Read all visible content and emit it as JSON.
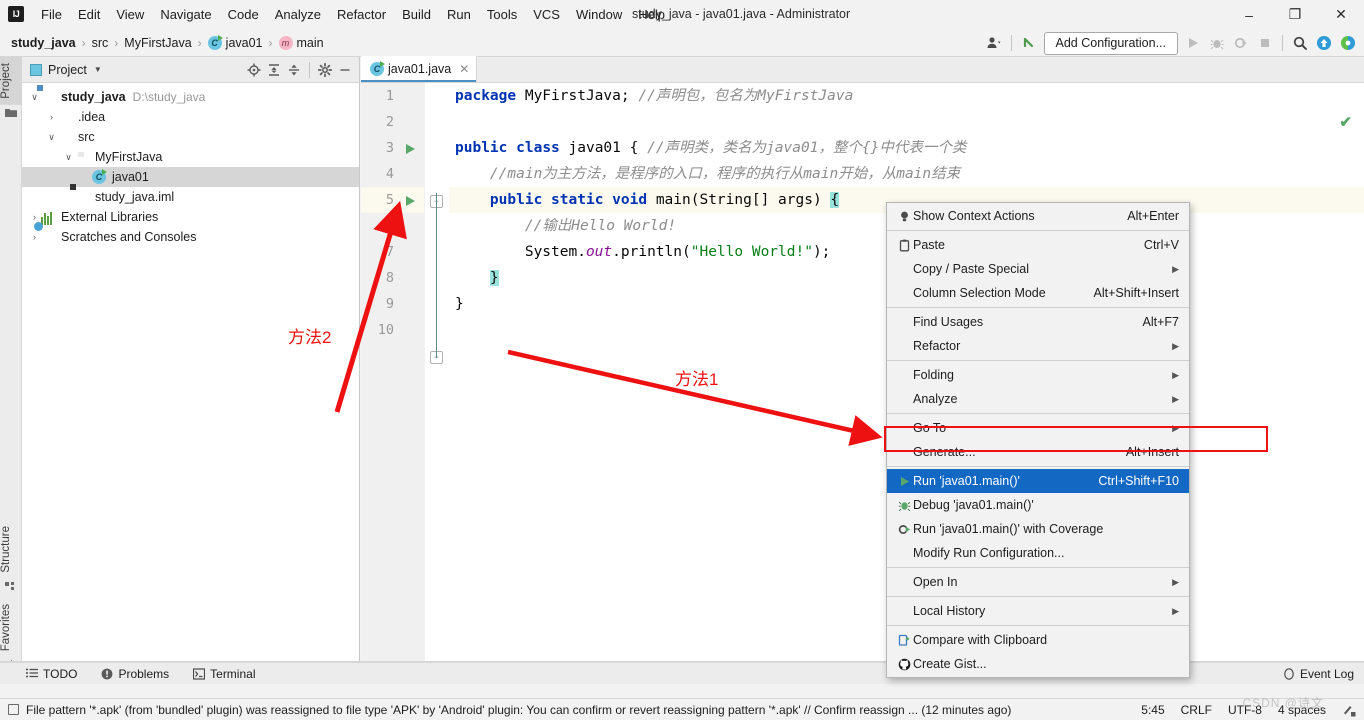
{
  "window": {
    "title": "study_java - java01.java - Administrator",
    "logo": "IJ",
    "minimize": "–",
    "maximize": "❐",
    "close": "✕"
  },
  "menubar": {
    "items": [
      {
        "label": "File"
      },
      {
        "label": "Edit"
      },
      {
        "label": "View"
      },
      {
        "label": "Navigate"
      },
      {
        "label": "Code"
      },
      {
        "label": "Analyze"
      },
      {
        "label": "Refactor"
      },
      {
        "label": "Build"
      },
      {
        "label": "Run"
      },
      {
        "label": "Tools"
      },
      {
        "label": "VCS"
      },
      {
        "label": "Window"
      },
      {
        "label": "Help"
      }
    ]
  },
  "breadcrumb": {
    "items": [
      {
        "label": "study_java",
        "icon": "none"
      },
      {
        "label": "src",
        "icon": "none"
      },
      {
        "label": "MyFirstJava",
        "icon": "none"
      },
      {
        "label": "java01",
        "icon": "class-icon"
      },
      {
        "label": "main",
        "icon": "method-icon"
      }
    ],
    "separator": "›"
  },
  "nav_toolbar": {
    "add_configuration": "Add Configuration...",
    "icons": [
      "user-avatar-icon",
      "back-arrow-icon",
      "run-icon",
      "debug-icon",
      "run-coverage-icon",
      "stop-icon",
      "search-everywhere-icon",
      "update-project-icon",
      "ide-assistant-icon"
    ]
  },
  "toolstrip": {
    "top": [
      "Project"
    ],
    "bottom": [
      "Structure",
      "Favorites"
    ]
  },
  "project_panel": {
    "title": "Project",
    "toolbar_icons": [
      "locate-icon",
      "expand-all-icon",
      "collapse-all-icon",
      "settings-gear-icon",
      "hide-icon"
    ],
    "tree": [
      {
        "label": "study_java",
        "path": "D:\\study_java",
        "depth": 0,
        "twist": "∨",
        "icon": "module-folder-icon",
        "bold": true,
        "selected": false
      },
      {
        "label": ".idea",
        "path": "",
        "depth": 1,
        "twist": "›",
        "icon": "folder-gray-icon",
        "bold": false,
        "selected": false
      },
      {
        "label": "src",
        "path": "",
        "depth": 1,
        "twist": "∨",
        "icon": "folder-blue-icon",
        "bold": false,
        "selected": false
      },
      {
        "label": "MyFirstJava",
        "path": "",
        "depth": 2,
        "twist": "∨",
        "icon": "package-folder-icon",
        "bold": false,
        "selected": false
      },
      {
        "label": "java01",
        "path": "",
        "depth": 3,
        "twist": "",
        "icon": "class-icon",
        "bold": false,
        "selected": true
      },
      {
        "label": "study_java.iml",
        "path": "",
        "depth": 2,
        "twist": "",
        "icon": "iml-file-icon",
        "bold": false,
        "selected": false
      },
      {
        "label": "External Libraries",
        "path": "",
        "depth": 0,
        "twist": "›",
        "icon": "libraries-icon",
        "bold": false,
        "selected": false
      },
      {
        "label": "Scratches and Consoles",
        "path": "",
        "depth": 0,
        "twist": "›",
        "icon": "scratches-icon",
        "bold": false,
        "selected": false
      }
    ]
  },
  "editor": {
    "tab": {
      "label": "java01.java",
      "close": "✕",
      "icon": "class-icon"
    },
    "inspection_status": "✔",
    "lines": [
      {
        "num": "1",
        "run_marker": false,
        "current": false
      },
      {
        "num": "2",
        "run_marker": false,
        "current": false
      },
      {
        "num": "3",
        "run_marker": true,
        "current": false
      },
      {
        "num": "4",
        "run_marker": false,
        "current": false
      },
      {
        "num": "5",
        "run_marker": true,
        "current": true
      },
      {
        "num": "6",
        "run_marker": false,
        "current": false
      },
      {
        "num": "7",
        "run_marker": false,
        "current": false
      },
      {
        "num": "8",
        "run_marker": false,
        "current": false
      },
      {
        "num": "9",
        "run_marker": false,
        "current": false
      },
      {
        "num": "10",
        "run_marker": false,
        "current": false
      }
    ],
    "code": {
      "l1_kw": "package",
      "l1_name": " MyFirstJava;",
      "l1_comment": "//声明包，包名为MyFirstJava",
      "l3_kw1": "public",
      "l3_kw2": "class",
      "l3_name": " java01 { ",
      "l3_comment": "//声明类，类名为java01，整个{}中代表一个类",
      "l4_comment": "//main为主方法，是程序的入口，程序的执行从main开始，从main结束",
      "l5_kw1": "public",
      "l5_kw2": "static",
      "l5_kw3": "void",
      "l5_rest": " main(String[] args) ",
      "l5_brace": "{",
      "l6_comment": "//输出Hello World!",
      "l7_pre": "System.",
      "l7_field": "out",
      "l7_mid": ".println(",
      "l7_str": "\"Hello World!\"",
      "l7_post": ");",
      "l8_brace": "}",
      "l9_brace": "}"
    }
  },
  "context_menu": {
    "items": [
      {
        "label": "Show Context Actions",
        "key": "Alt+Enter",
        "icon": "lightbulb-icon",
        "arrow": false,
        "selected": false,
        "sep_after": true
      },
      {
        "label": "Paste",
        "key": "Ctrl+V",
        "icon": "clipboard-icon",
        "arrow": false,
        "selected": false,
        "sep_after": false,
        "mnemonic": "P"
      },
      {
        "label": "Copy / Paste Special",
        "key": "",
        "icon": "",
        "arrow": true,
        "selected": false,
        "sep_after": false
      },
      {
        "label": "Column Selection Mode",
        "key": "Alt+Shift+Insert",
        "icon": "",
        "arrow": false,
        "selected": false,
        "sep_after": true,
        "mnemonic": "M"
      },
      {
        "label": "Find Usages",
        "key": "Alt+F7",
        "icon": "",
        "arrow": false,
        "selected": false,
        "sep_after": false,
        "mnemonic": "U"
      },
      {
        "label": "Refactor",
        "key": "",
        "icon": "",
        "arrow": true,
        "selected": false,
        "sep_after": true,
        "mnemonic": "R"
      },
      {
        "label": "Folding",
        "key": "",
        "icon": "",
        "arrow": true,
        "selected": false,
        "sep_after": false
      },
      {
        "label": "Analyze",
        "key": "",
        "icon": "",
        "arrow": true,
        "selected": false,
        "sep_after": true,
        "mnemonic": "z"
      },
      {
        "label": "Go To",
        "key": "",
        "icon": "",
        "arrow": true,
        "selected": false,
        "sep_after": false
      },
      {
        "label": "Generate...",
        "key": "Alt+Insert",
        "icon": "",
        "arrow": false,
        "selected": false,
        "sep_after": true
      },
      {
        "label": "Run 'java01.main()'",
        "key": "Ctrl+Shift+F10",
        "icon": "run-icon",
        "arrow": false,
        "selected": true,
        "sep_after": false,
        "mnemonic": "u"
      },
      {
        "label": "Debug 'java01.main()'",
        "key": "",
        "icon": "debug-icon",
        "arrow": false,
        "selected": false,
        "sep_after": false,
        "mnemonic": "D"
      },
      {
        "label": "Run 'java01.main()' with Coverage",
        "key": "",
        "icon": "coverage-icon",
        "arrow": false,
        "selected": false,
        "sep_after": false,
        "mnemonic": "v"
      },
      {
        "label": "Modify Run Configuration...",
        "key": "",
        "icon": "",
        "arrow": false,
        "selected": false,
        "sep_after": true
      },
      {
        "label": "Open In",
        "key": "",
        "icon": "",
        "arrow": true,
        "selected": false,
        "sep_after": true
      },
      {
        "label": "Local History",
        "key": "",
        "icon": "",
        "arrow": true,
        "selected": false,
        "sep_after": true,
        "mnemonic": "H"
      },
      {
        "label": "Compare with Clipboard",
        "key": "",
        "icon": "compare-icon",
        "arrow": false,
        "selected": false,
        "sep_after": false,
        "mnemonic": "b"
      },
      {
        "label": "Create Gist...",
        "key": "",
        "icon": "github-icon",
        "arrow": false,
        "selected": false,
        "sep_after": false
      }
    ]
  },
  "annotations": {
    "method1": "方法1",
    "method2": "方法2",
    "arrow_color": "#ee1111",
    "highlight_color": "#ee1111"
  },
  "tool_window_bar": {
    "items": [
      {
        "label": "TODO",
        "icon": "todo-list-icon"
      },
      {
        "label": "Problems",
        "icon": "problems-icon"
      },
      {
        "label": "Terminal",
        "icon": "terminal-icon"
      }
    ],
    "right": {
      "label": "Event Log",
      "icon": "event-log-icon"
    }
  },
  "statusbar": {
    "message": "File pattern '*.apk' (from 'bundled' plugin) was reassigned to file type 'APK' by 'Android' plugin: You can confirm or revert reassigning pattern '*.apk' // Confirm reassign ... (12 minutes ago)",
    "caret": "5:45",
    "line_separator": "CRLF",
    "encoding": "UTF-8",
    "indent": "4 spaces",
    "lock_icon": "read-write-icon"
  },
  "watermark": "CSDN @诗文",
  "colors": {
    "accent_blue": "#1268c3",
    "run_green": "#59a869",
    "keyword_blue": "#0033b3",
    "string_green": "#067d17",
    "comment_gray": "#8c8c8c",
    "field_purple": "#871094",
    "selection_teal": "#99e3dc",
    "annotation_red": "#ee1111"
  }
}
